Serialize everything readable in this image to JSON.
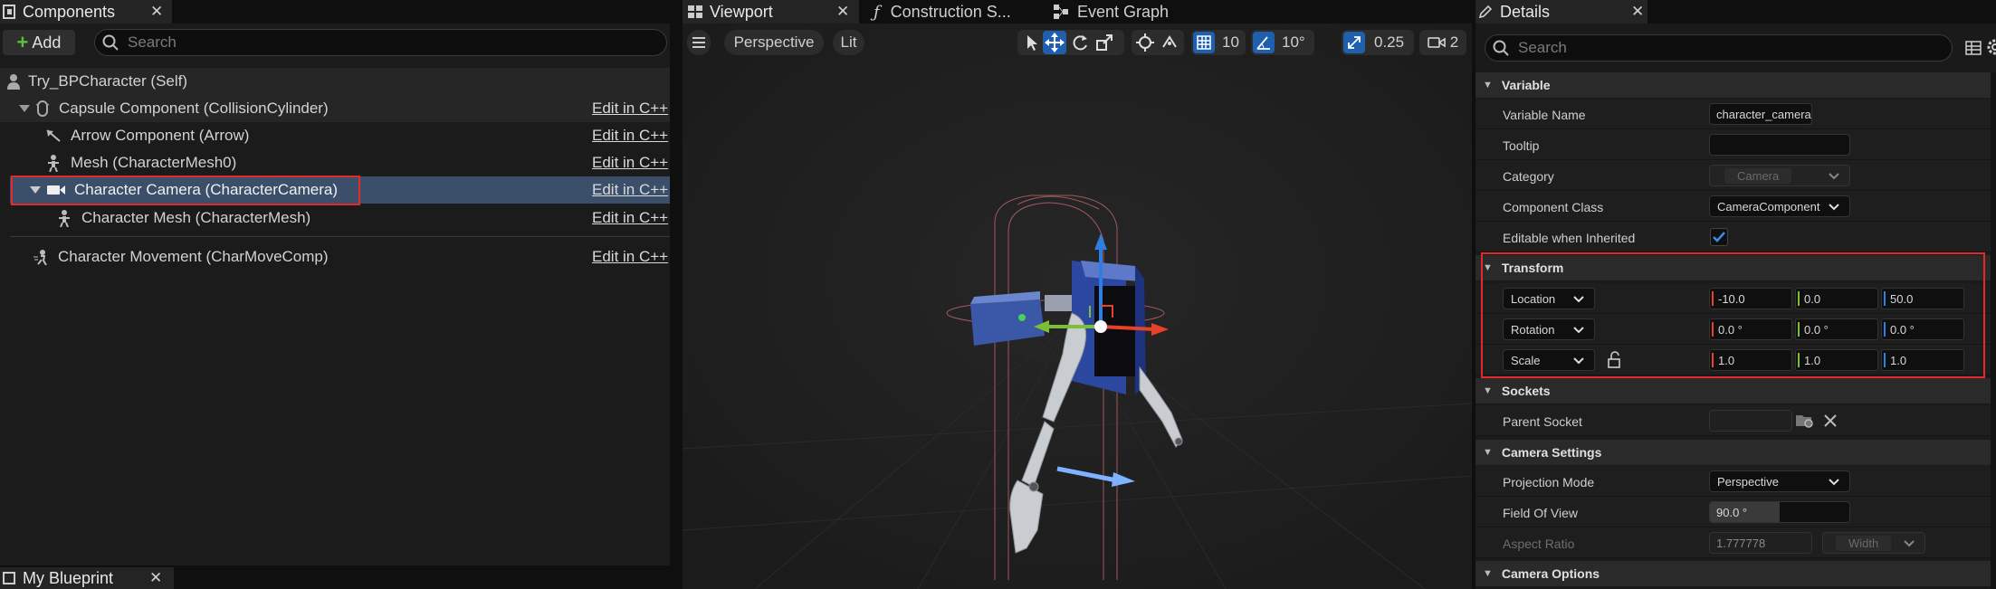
{
  "components_panel": {
    "tab_label": "Components",
    "add_label": "Add",
    "search_placeholder": "Search",
    "items": [
      {
        "label": "Try_BPCharacter (Self)",
        "edit": ""
      },
      {
        "label": "Capsule Component (CollisionCylinder)",
        "edit": "Edit in C++"
      },
      {
        "label": "Arrow Component (Arrow)",
        "edit": "Edit in C++"
      },
      {
        "label": "Mesh (CharacterMesh0)",
        "edit": "Edit in C++"
      },
      {
        "label": "Character Camera (CharacterCamera)",
        "edit": "Edit in C++"
      },
      {
        "label": "Character Mesh (CharacterMesh)",
        "edit": "Edit in C++"
      },
      {
        "label": "Character Movement (CharMoveComp)",
        "edit": "Edit in C++"
      }
    ]
  },
  "my_blueprint": {
    "tab_label": "My Blueprint"
  },
  "editor_tabs": [
    {
      "label": "Viewport"
    },
    {
      "label": "Construction S..."
    },
    {
      "label": "Event Graph"
    }
  ],
  "viewport_toolbar": {
    "perspective": "Perspective",
    "lit": "Lit",
    "grid_snap": "10",
    "rotation_snap": "10°",
    "scale_snap": "0.25",
    "camera_speed": "2"
  },
  "details": {
    "tab_label": "Details",
    "search_placeholder": "Search",
    "variable": {
      "section": "Variable",
      "variable_name_label": "Variable Name",
      "variable_name_value": "character_camera",
      "tooltip_label": "Tooltip",
      "tooltip_value": "",
      "category_label": "Category",
      "category_value": "Camera",
      "component_class_label": "Component Class",
      "component_class_value": "CameraComponent",
      "editable_label": "Editable when Inherited",
      "editable_checked": true
    },
    "transform": {
      "section": "Transform",
      "location_label": "Location",
      "location": [
        "-10.0",
        "0.0",
        "50.0"
      ],
      "rotation_label": "Rotation",
      "rotation": [
        "0.0 °",
        "0.0 °",
        "0.0 °"
      ],
      "scale_label": "Scale",
      "scale": [
        "1.0",
        "1.0",
        "1.0"
      ]
    },
    "sockets": {
      "section": "Sockets",
      "parent_socket_label": "Parent Socket",
      "parent_socket_value": ""
    },
    "camera_settings": {
      "section": "Camera Settings",
      "projection_label": "Projection Mode",
      "projection_value": "Perspective",
      "fov_label": "Field Of View",
      "fov_value": "90.0 °",
      "fov_fraction": 0.5,
      "aspect_label": "Aspect Ratio",
      "aspect_value": "1.777778",
      "aspect_axis": "Width"
    },
    "camera_options": {
      "section": "Camera Options"
    }
  },
  "colors": {
    "x_axis": "#e8412b",
    "y_axis": "#7bbf34",
    "z_axis": "#2e7de0",
    "selection": "#3b4f6a",
    "highlight": "#e32a2a",
    "active_toggle": "#1f5fae"
  }
}
